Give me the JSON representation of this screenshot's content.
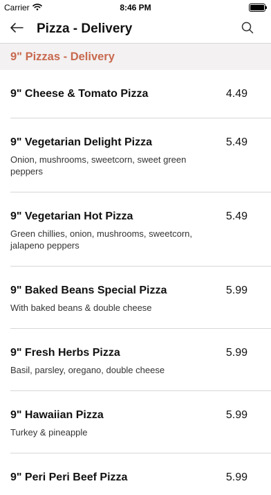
{
  "status_bar": {
    "carrier": "Carrier",
    "time": "8:46 PM",
    "icons": [
      "wifi-icon",
      "battery-icon"
    ]
  },
  "nav": {
    "title": "Pizza - Delivery",
    "back_icon": "arrow-left-icon",
    "search_icon": "search-icon"
  },
  "section": {
    "title": "9\" Pizzas - Delivery",
    "accent_color": "#c8694f"
  },
  "items": [
    {
      "name": "9\" Cheese & Tomato Pizza",
      "price": "4.49",
      "description": ""
    },
    {
      "name": "9\" Vegetarian Delight Pizza",
      "price": "5.49",
      "description": "Onion, mushrooms, sweetcorn, sweet green peppers"
    },
    {
      "name": "9\" Vegetarian Hot Pizza",
      "price": "5.49",
      "description": "Green chillies, onion, mushrooms, sweetcorn, jalapeno peppers"
    },
    {
      "name": "9\" Baked Beans Special Pizza",
      "price": "5.99",
      "description": "With baked beans & double cheese"
    },
    {
      "name": "9\" Fresh Herbs Pizza",
      "price": "5.99",
      "description": "Basil, parsley, oregano, double cheese"
    },
    {
      "name": "9\" Hawaiian Pizza",
      "price": "5.99",
      "description": "Turkey & pineapple"
    },
    {
      "name": "9\" Peri Peri Beef Pizza",
      "price": "5.99",
      "description": ""
    }
  ]
}
